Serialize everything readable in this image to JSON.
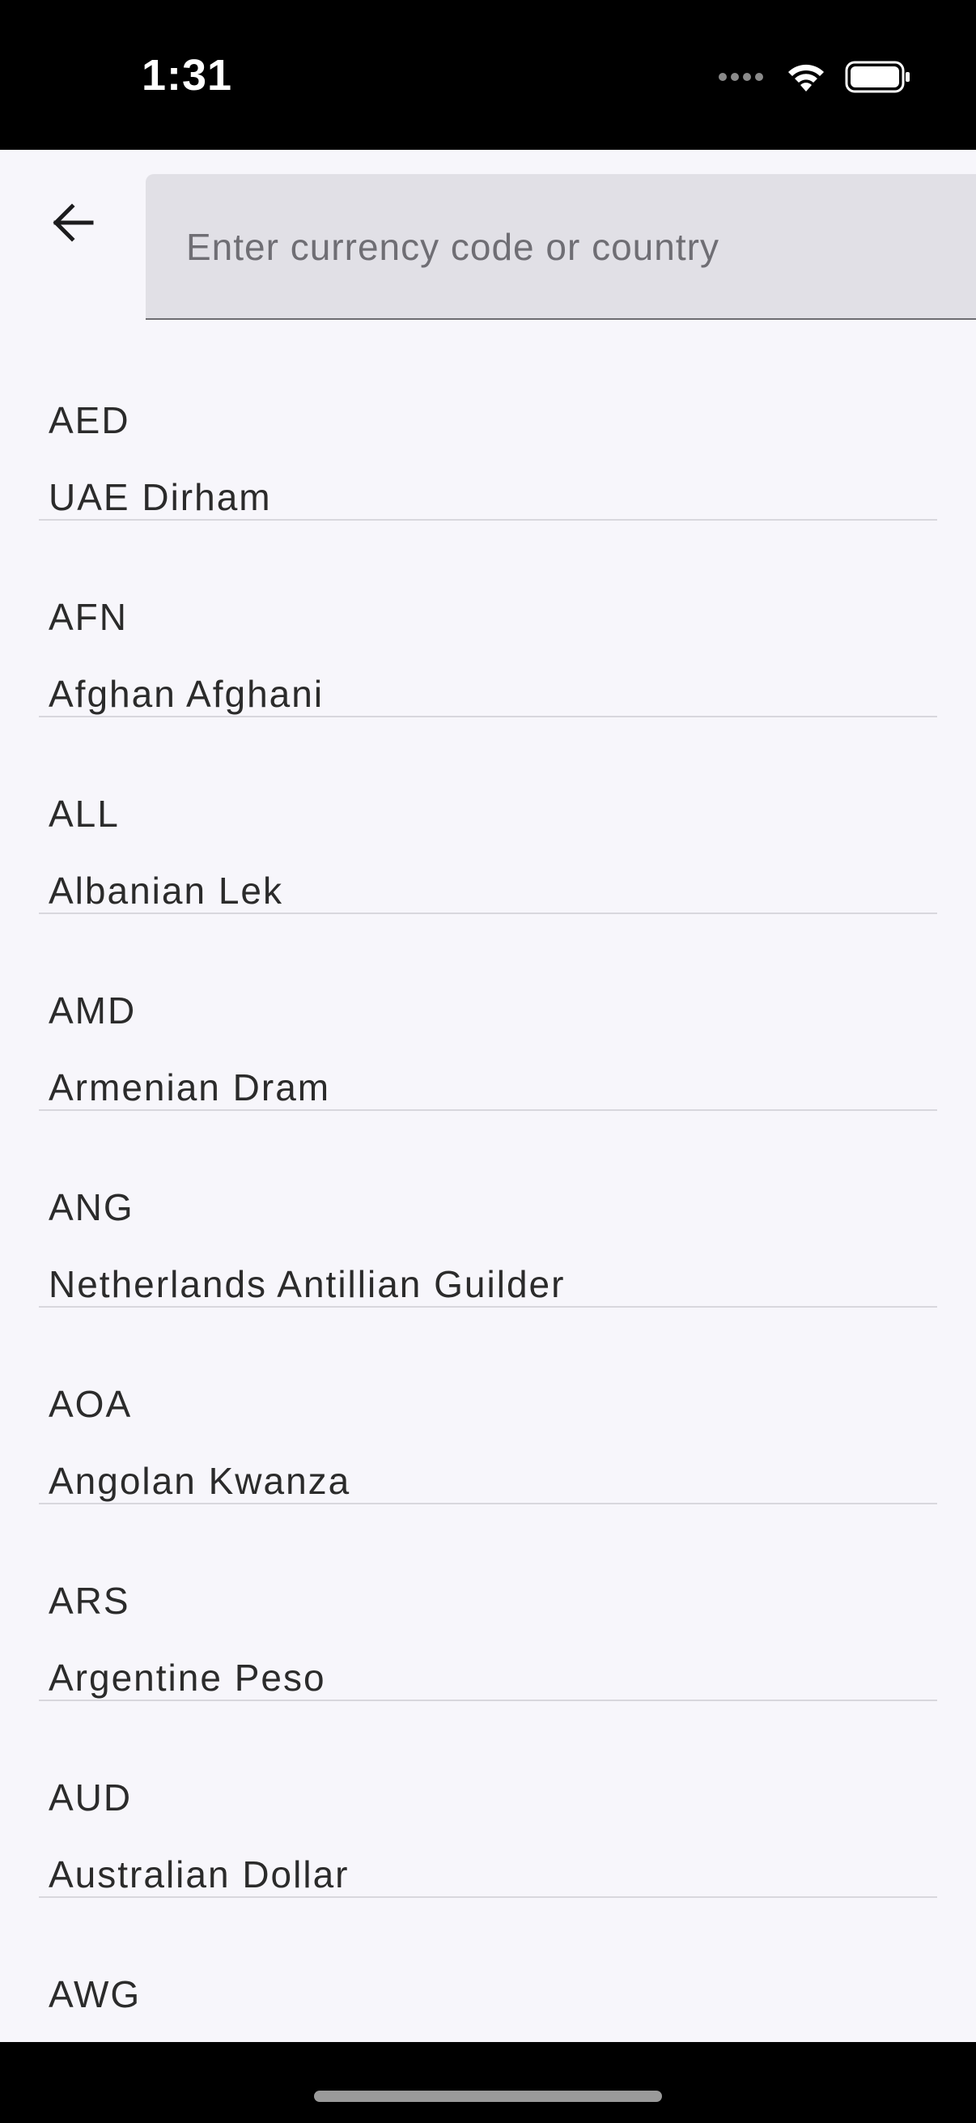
{
  "status_bar": {
    "time": "1:31"
  },
  "header": {
    "back_icon": "arrow-left-icon"
  },
  "search": {
    "placeholder": "Enter currency code or country",
    "value": ""
  },
  "currencies": [
    {
      "code": "AED",
      "name": "UAE Dirham"
    },
    {
      "code": "AFN",
      "name": "Afghan Afghani"
    },
    {
      "code": "ALL",
      "name": "Albanian Lek"
    },
    {
      "code": "AMD",
      "name": "Armenian Dram"
    },
    {
      "code": "ANG",
      "name": "Netherlands Antillian Guilder"
    },
    {
      "code": "AOA",
      "name": "Angolan Kwanza"
    },
    {
      "code": "ARS",
      "name": "Argentine Peso"
    },
    {
      "code": "AUD",
      "name": "Australian Dollar"
    },
    {
      "code": "AWG",
      "name": ""
    }
  ],
  "colors": {
    "background": "#f7f6fb",
    "search_field_bg": "#e1e0e6",
    "text": "#2b2b2b",
    "placeholder": "#6f6e74",
    "divider": "#d8d7dd"
  }
}
